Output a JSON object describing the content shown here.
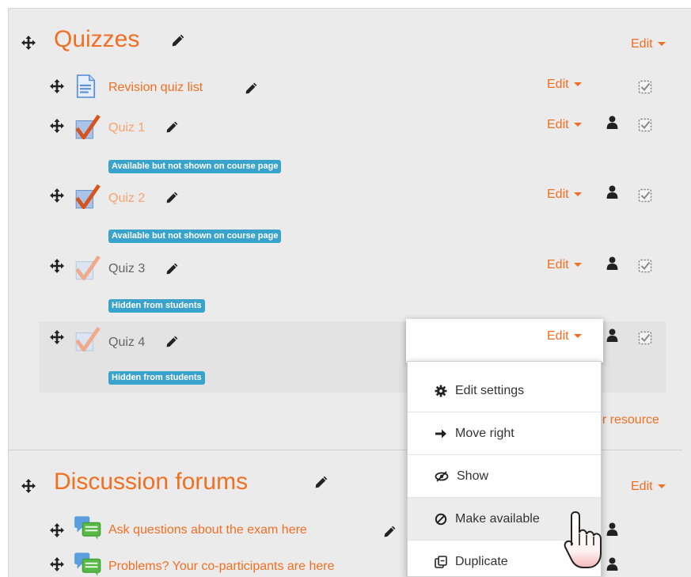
{
  "sections": [
    {
      "title": "Quizzes",
      "edit_label": "Edit",
      "activities": [
        {
          "name": "Revision quiz list",
          "icon": "page-icon",
          "edit": "Edit"
        },
        {
          "name": "Quiz 1",
          "icon": "quiz-icon",
          "edit": "Edit",
          "badge": "Available but not shown on course page"
        },
        {
          "name": "Quiz 2",
          "icon": "quiz-icon",
          "edit": "Edit",
          "badge": "Available but not shown on course page"
        },
        {
          "name": "Quiz 3",
          "icon": "quiz-icon-faded",
          "edit": "Edit",
          "badge": "Hidden from students"
        },
        {
          "name": "Quiz 4",
          "icon": "quiz-icon-faded",
          "edit": "Edit",
          "badge": "Hidden from students"
        }
      ],
      "add_link_partial": "or resource"
    },
    {
      "title": "Discussion forums",
      "edit_label": "Edit",
      "activities": [
        {
          "name": "Ask questions about the exam here",
          "icon": "forum-icon"
        },
        {
          "name": "Problems? Your co-participants are here",
          "icon": "forum-icon"
        }
      ]
    }
  ],
  "edit_menu": {
    "items": [
      {
        "label": "Edit settings",
        "icon": "gear-icon"
      },
      {
        "label": "Move right",
        "icon": "arrow-right-icon"
      },
      {
        "label": "Show",
        "icon": "eye-icon"
      },
      {
        "label": "Make available",
        "icon": "ban-icon"
      },
      {
        "label": "Duplicate",
        "icon": "duplicate-icon"
      }
    ]
  },
  "colors": {
    "accent": "#f26f21",
    "badge": "#3aa3cc",
    "background": "#ebebeb"
  }
}
